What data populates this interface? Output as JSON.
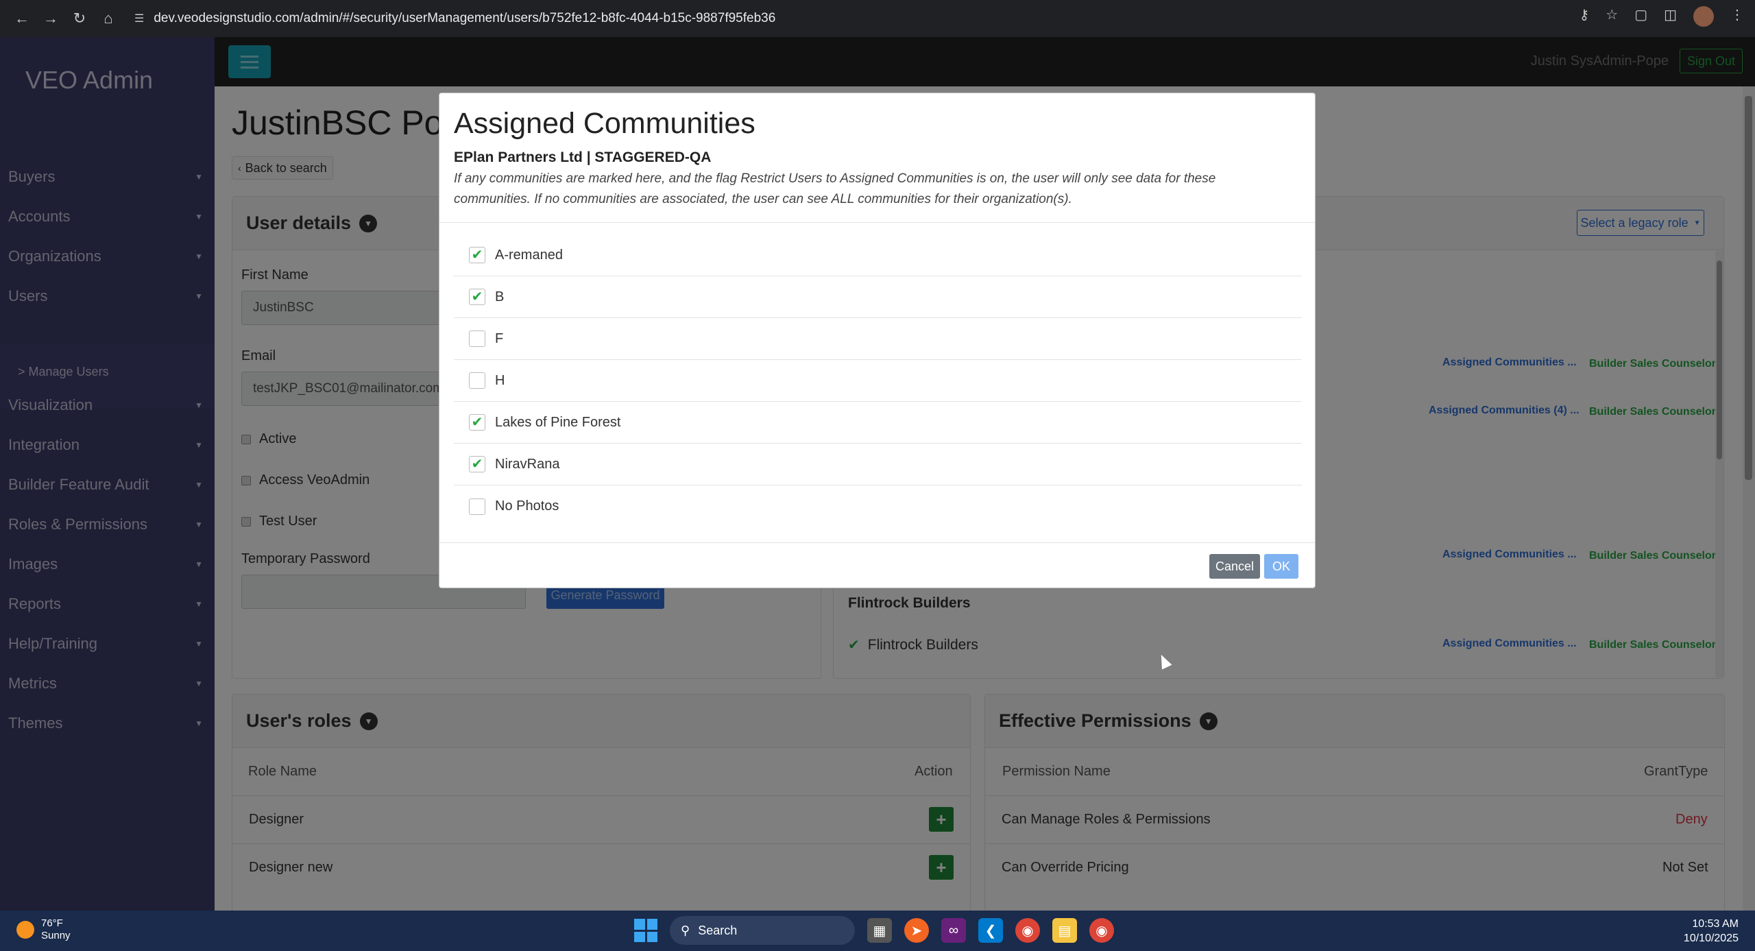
{
  "browser": {
    "url": "dev.veodesignstudio.com/admin/#/security/userManagement/users/b752fe12-b8fc-4044-b15c-9887f95feb36"
  },
  "sidebar": {
    "brand": "VEO Admin",
    "items": [
      {
        "label": "Buyers"
      },
      {
        "label": "Accounts"
      },
      {
        "label": "Organizations"
      },
      {
        "label": "Users"
      },
      {
        "label": "Visualization"
      },
      {
        "label": "Integration"
      },
      {
        "label": "Builder Feature Audit"
      },
      {
        "label": "Roles & Permissions"
      },
      {
        "label": "Images"
      },
      {
        "label": "Reports"
      },
      {
        "label": "Help/Training"
      },
      {
        "label": "Metrics"
      },
      {
        "label": "Themes"
      }
    ],
    "sub_item": "> Manage Users"
  },
  "header": {
    "user_name": "Justin SysAdmin-Pope",
    "signout": "Sign Out"
  },
  "page": {
    "title": "JustinBSC Pop",
    "back": "Back to search",
    "user_details": {
      "heading": "User details",
      "first_name_label": "First Name",
      "first_name_value": "JustinBSC",
      "email_label": "Email",
      "email_value": "testJKP_BSC01@mailinator.com",
      "active_label": "Active",
      "access_label": "Access VeoAdmin",
      "test_user_label": "Test User",
      "temp_password_label": "Temporary Password",
      "generate_password": "Generate Password"
    },
    "legacy_role": "Select a legacy role",
    "assign_rows": [
      {
        "link": "Assigned Communities ...",
        "role": "Builder Sales Counselor"
      },
      {
        "link": "Assigned Communities (4) ...",
        "role": "Builder Sales Counselor"
      },
      {
        "link": "Assigned Communities ...",
        "role": "Builder Sales Counselor"
      },
      {
        "link": "Assigned Communities ...",
        "role": "Builder Sales Counselor"
      }
    ],
    "org_title": "Flintrock Builders",
    "org_check_label": "Flintrock Builders",
    "roles": {
      "heading": "User's roles",
      "col_name": "Role Name",
      "col_action": "Action",
      "rows": [
        "Designer",
        "Designer new"
      ]
    },
    "permissions": {
      "heading": "Effective Permissions",
      "col_name": "Permission Name",
      "col_grant": "GrantType",
      "rows": [
        {
          "name": "Can Manage Roles & Permissions",
          "grant": "Deny"
        },
        {
          "name": "Can Override Pricing",
          "grant": "Not Set"
        }
      ]
    }
  },
  "modal": {
    "title": "Assigned Communities",
    "subtitle": "EPlan Partners Ltd | STAGGERED-QA",
    "description": "If any communities are marked here, and the flag Restrict Users to Assigned Communities is on, the user will only see data for these communities. If no communities are associated, the user can see ALL communities for their organization(s).",
    "communities": [
      {
        "label": "A-remaned",
        "checked": true
      },
      {
        "label": "B",
        "checked": true
      },
      {
        "label": "F",
        "checked": false
      },
      {
        "label": "H",
        "checked": false
      },
      {
        "label": "Lakes of Pine Forest",
        "checked": true
      },
      {
        "label": "NiravRana",
        "checked": true
      },
      {
        "label": "No Photos",
        "checked": false
      }
    ],
    "cancel": "Cancel",
    "ok": "OK"
  },
  "taskbar": {
    "temp": "76°F",
    "condition": "Sunny",
    "search": "Search",
    "time": "10:53 AM",
    "date": "10/10/2025"
  }
}
